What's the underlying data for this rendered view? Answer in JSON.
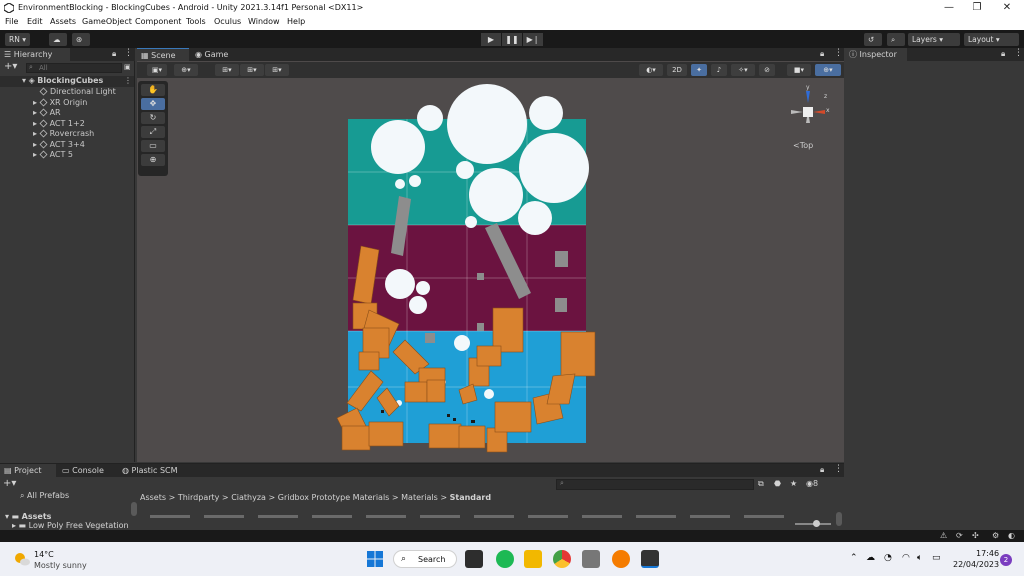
{
  "window": {
    "title": "EnvironmentBlocking - BlockingCubes - Android - Unity 2021.3.14f1 Personal <DX11>",
    "controls": [
      "—",
      "❐",
      "✕"
    ]
  },
  "menu": [
    "File",
    "Edit",
    "Assets",
    "GameObject",
    "Component",
    "Tools",
    "Oculus",
    "Window",
    "Help"
  ],
  "toolbar": {
    "account": "RN ▾",
    "play": "▶",
    "pause": "❚❚",
    "step": "▶❘",
    "layers": "Layers",
    "layout": "Layout"
  },
  "hierarchy": {
    "tab": "Hierarchy",
    "search_placeholder": "All",
    "scene": "BlockingCubes",
    "items": [
      "Directional Light",
      "XR Origin",
      "AR",
      "ACT 1+2",
      "Rovercrash",
      "ACT 3+4",
      "ACT 5"
    ]
  },
  "scene_view": {
    "tabs": [
      "Scene",
      "Game"
    ],
    "toggle_2d": "2D",
    "gizmo_label": "Top",
    "gizmo_axes": [
      "y",
      "x",
      "z"
    ]
  },
  "inspector": {
    "tab": "Inspector"
  },
  "bottom": {
    "tabs": [
      "Project",
      "Console",
      "Plastic SCM"
    ],
    "favorites": "All Prefabs",
    "assets_root": "Assets",
    "asset_child": "Low Poly Free Vegetation",
    "breadcrumb": [
      "Assets",
      "Thirdparty",
      "Ciathyza",
      "Gridbox Prototype Materials",
      "Materials",
      "Standard"
    ],
    "hidden_count": "8"
  },
  "taskbar": {
    "temperature": "14°C",
    "weather": "Mostly sunny",
    "search": "Search",
    "time": "17:46",
    "date": "22/04/2023",
    "notifications": "2"
  },
  "colors": {
    "teal": "#179b93",
    "maroon": "#6b1340",
    "blue": "#1f9fd6",
    "cube": "#d9822f",
    "grey_block": "#8d8d8d"
  }
}
